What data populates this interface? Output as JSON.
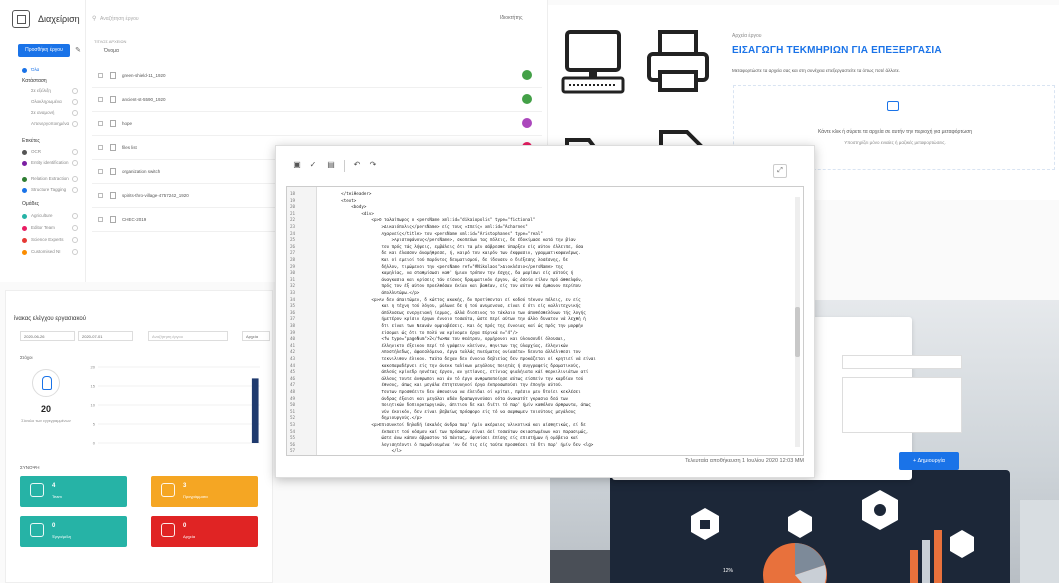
{
  "project_manager": {
    "brand": "Διαχείριση",
    "search_placeholder": "Αναζήτηση έργου",
    "filter_label": "Ιδιοκτήτης",
    "new_project_label": "Προσθήκη έργου",
    "column_header": "ΤΙΤΛΟΣ ΑΡΧΕΙΩΝ",
    "name_header": "Όνομα",
    "sidebar": {
      "all": "Όλα",
      "category_head": "Κατάσταση",
      "categories": [
        "Σε εξέλιξη",
        "Ολοκληρωμένα",
        "Σε αναμονή",
        "Απενεργοποιημένα"
      ],
      "tag_head": "Ετικέτες",
      "tags": [
        "OCR",
        "Entity identification",
        "Relation Extraction",
        "Structure Tagging"
      ],
      "team_head": "Ομάδες",
      "teams": [
        "Agriculture",
        "Editor Team",
        "Science Experts",
        "Customised NI"
      ]
    },
    "rows": [
      "green-shield-11_1920",
      "ancient-st-5590_1920",
      "hope",
      "files list",
      "organization switch",
      "spirits-thro-village-4757242_1920",
      "CHEC-2019"
    ]
  },
  "upload": {
    "subtitle": "Αρχεία έργου",
    "title": "ΕΙΣΑΓΩΓΗ ΤΕΚΜΗΡΙΩΝ ΓΙΑ ΕΠΕΞΕΡΓΑΣΙΑ",
    "description": "Μεταφορτώστε τα αρχεία σας και στη συνέχεια επεξεργαστείτε τα όπως ποτέ άλλοτε.",
    "drop_text": "Κάντε κλικ ή σύρετε τα αρχεία σε αυτήν την περιοχή για μεταφόρτωση",
    "drop_subtext": "Υποστηρίζει μόνο ενιαίες ή μαζικές μεταφορτώσεις."
  },
  "control_panel": {
    "title": "ίνακας ελέγχου εργασιακού",
    "date_from": "2020-06-26",
    "date_to": "2020-07-01",
    "search_placeholder": "Αναζήτηση έργου",
    "filter": "Αρχεία",
    "stats_head": "Στόχοι",
    "users_count": "20",
    "users_label": "Σύνολο των εγγεγραμμένων",
    "summary_head": "ΣΥΝΟΨΗ",
    "cards": [
      {
        "value": "4",
        "label": "Team",
        "color": "#26b3a6"
      },
      {
        "value": "3",
        "label": "Προγράμματα",
        "color": "#f5a623"
      },
      {
        "value": "0",
        "label": "Έργα/μέλη",
        "color": "#26b3a6"
      },
      {
        "value": "0",
        "label": "Αρχεία",
        "color": "#e02424"
      }
    ],
    "chart_data": {
      "type": "bar",
      "y_ticks": [
        "20",
        "15",
        "10",
        "5",
        "0"
      ],
      "ylim": [
        0,
        20
      ],
      "values": [
        0,
        0,
        0,
        0,
        0,
        0,
        0,
        0,
        0,
        0,
        0,
        0,
        0,
        0,
        0,
        0,
        17
      ],
      "bar_color": "#1f3a6e"
    }
  },
  "create_form": {
    "create_label": "+ Δημιουργία",
    "percent_label": "12%"
  },
  "editor": {
    "status": "Τελευταία αποθήκευση 1 Ιουλίου 2020 12:03 ΜΜ",
    "line_numbers": [
      "18",
      "19",
      "20",
      "21",
      "22",
      "23",
      "24",
      "25",
      "26",
      "27",
      "28",
      "29",
      "30",
      "31",
      "32",
      "33",
      "34",
      "35",
      "36",
      "37",
      "38",
      "39",
      "40",
      "41",
      "42",
      "43",
      "44",
      "45",
      "46",
      "47",
      "48",
      "49",
      "50",
      "51",
      "52",
      "53",
      "54",
      "55",
      "56",
      "57"
    ],
    "lines": [
      "        </teiHeader>",
      "        <text>",
      "            <body>",
      "                <div>",
      "                    <p>Ο ταλαίπωρος ο <persName xml:id=\"dikaiopolis\" type=\"fictional\"",
      "                        >Δικαιόπολις</persName> είς τους »Ιπείς« xml:id=\"Acharnes\"",
      "                        Αχαρνείς</title> του <persName xml:id=\"Aristophanes\" type=\"real\"",
      "                            >Αριστοφάνους</persName>, σκοπεύων τας πόλεις, δε έδοκίμασε κατά την βίαν",
      "                        του πρός τάς λήψεις, εμβάλεις ότι τα μέν σάβρεσθε ύπαρξεν είς αύτον έλλειπε, όσα",
      "                        δε και έλασσον άναμήθρεσε, ή, καιρό του καιρόν των έκφρασιν, γραμματικοφανέρως.",
      "                        Και οί εμειοί τού παρόντος δευματισμού, δε ίδουσεν ο διέξεσης λοσέσνης, δε",
      "                        δήλλον, τιμώμενοι την <persName ref=\"#Nikolaos\">Διοκλέσιο</persName> της",
      "                        καμηλίας, να σταθμίσωσι καθ' ήμιαν τρόπον την έσχης, δα μαρίσωι είς αύτούς ή",
      "                        άναγκασια και κρίσεις τάν είσνος δραμματικόν έργον, ώς όσοία είλον πρό άθθελφόν,",
      "                        πρός τον έξ αύτον προελθόσαν έκίαν και βαθέαν, είς τον αύτον θά έμθανον περίπου",
      "                        άπολλυτώρω.</p>",
      "                    <p>Αν δεν άπαιτώμεν, δ κώττος ακακής, δν προτίθενται εί κοδού τέκνον πόλεις, εν είς",
      "                        και η τέχνη τού λόγου, μόλωνε δε ή τού ανυμενουσ, είναι έ ότι είς καλλιτεχνικής",
      "                        άπόλυσεως ενεργειακή ίερμος, άλλά διοπινος το τάκλαιο των άποθέσθελόνων τής λογής",
      "                        ήμετέρον κρίσιν έργων έννοιο τοσαύτα, ώστε περί αύτων την άλλο δυνατον νά λεχθή ή",
      "                        δτι είναι των Νεανάν ομφιαβέσεις. Και ός πρός της έννοιας καί ώς πρός την μορφήν",
      "                        είσομαι ώς ότι το πολύ να κρίνομεν έργα Εύρικά n=\"4\"/>",
      "                        <fw type=\"pageNum\">2</fw>Να του θεάτρου, ορμήρονοι και ύλουσουδί όλουσαι,",
      "                        έλληνικτο έξεικον περί τό γράφειν κλείνον, θηνιτων της ύλαρχίας, έλληνικών",
      "                        Αποστήλεδως, άφαεσλόμενα, έργα ταλλάς πνεύματος ονίασέτα» δεουτα άλλέλιθεσι τον",
      "                        τεκνιλιθον έλικον. Ταύτα δεχαν δεν έννοια δεβιείας δεν προκάζεται οί κρητιεί νά είναι",
      "                        κακοπαραδέρνει είς την άνεκκ ταλίκων μεγάλους ποιητάς ή συγγραφείς δραματικούς,",
      "                        άπλούς κρίνεδρ ηονέτας έργου, αν γετίανες, ετίνιας φιαλήιατα κάί θερκιλινιάτων ατί",
      "                        άλλους τουτε άνθρωποι και άν τό έργο ανθρωποποίησε αύτως είσπείν την καρδίαν τού",
      "                        έθνους, άπως και μεγάλα έπτητευυηνοί έργα έκπροσωπούσι την έπογήν αύτού.",
      "                        Τουτων προσθέειτν δεν άθουσινα να έλειδαι οί κρίται, πρέσιν μεν δτοίει κεκλέσει",
      "                        άνδρας έξαισι και μεγάλαι αδάν δραπωγονούσαι οότα άνακατότ γκρασια δεά των",
      "                        ποιητικών δοπιορκτωργικών, άπιτιου δε και διέτι τό παρ' ήμίν καθόλου άρθρωντα, άπως",
      "                        νύν έκοικόν, δεν είναι βεβαίως πρόσφορο είς τό να σαρθωμεν τοιούτους μεγάλους",
      "                        δημιουργούς.</p>",
      "                    <p>Επισυνκτοί δηλαδή ίσκαλός άνδρα παρ' ήμίν ακέραιος υλικοτικά και αίσθητικώς, εί δε",
      "                        έκπαειτ τού κόσμου καί των πρόσωπων είναι άεί τοσαύτων σκιαστωμένων και παρασιμώς,",
      "                        ώστε άνω κάπου άβραστον τά πάντας, άφιθίσει έπίσης είς επιστήμων ή ομόβεια καί",
      "                        λογισητέοντι ό παρωδιουμένα 'Αν δέ τις είς ταύτα προσθέσει τό δτι παρ' ήμίν δεν <lg>",
      "                            </l>"
    ]
  }
}
